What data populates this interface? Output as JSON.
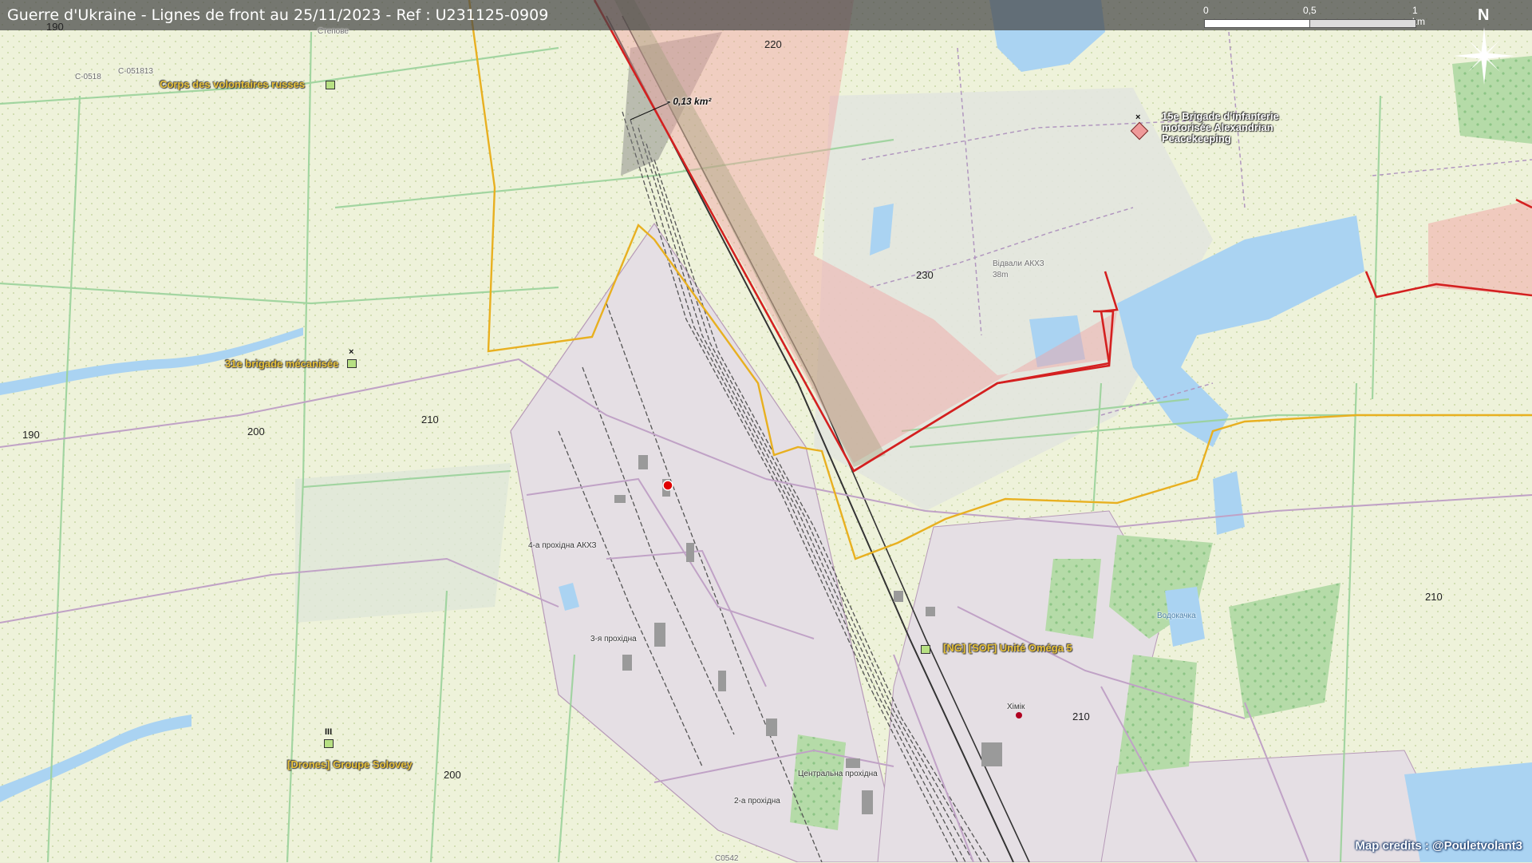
{
  "header": {
    "title": "Guerre d'Ukraine - Lignes de front au 25/11/2023 - Ref : U231125-0909"
  },
  "scale_bar": {
    "ticks": [
      "0",
      "0,5",
      "1 km"
    ]
  },
  "compass": {
    "label": "N"
  },
  "colors": {
    "frontline_ua": "#e8b020",
    "frontline_ru": "#d42020",
    "russian_area": "#f0a0a0",
    "grey_zone": "#7a7a7a",
    "water": "#aad3f2",
    "field": "#eaefd6",
    "industrial": "#e4dfe3",
    "forest": "#b8dcac",
    "unit_label": "#e8c23a"
  },
  "units": [
    {
      "label": "Corps des volontaires russes",
      "echelon": ""
    },
    {
      "label": "31e brigade mécanisée",
      "echelon": "×"
    },
    {
      "label": "[Drones] Groupe Solovey",
      "echelon": "III"
    },
    {
      "label": "[NG] [SOF] Unité Oméga 5",
      "echelon": ""
    },
    {
      "label": "15e Brigade d'infanterie motorisée Alexandrian Peacekeeping",
      "echelon": "×"
    }
  ],
  "annotations": {
    "area_change": "- 0,13 km²"
  },
  "elevations": [
    "190",
    "220",
    "230",
    "190",
    "200",
    "210",
    "210",
    "210",
    "200"
  ],
  "places": {
    "spoil": "Відвали АКХЗ",
    "spoil_height": "38m",
    "gate4": "4-а прохідна АКХЗ",
    "gate3": "3-я прохідна",
    "gate2": "2-а прохідна",
    "central": "Центральна прохідна",
    "khimik": "Хімік",
    "water_tower": "Водокачка",
    "road1": "C-0518",
    "road2": "C-051813",
    "stepove": "Степове",
    "road3": "C0542"
  },
  "credits": "Map credits : @Pouletvolant3"
}
